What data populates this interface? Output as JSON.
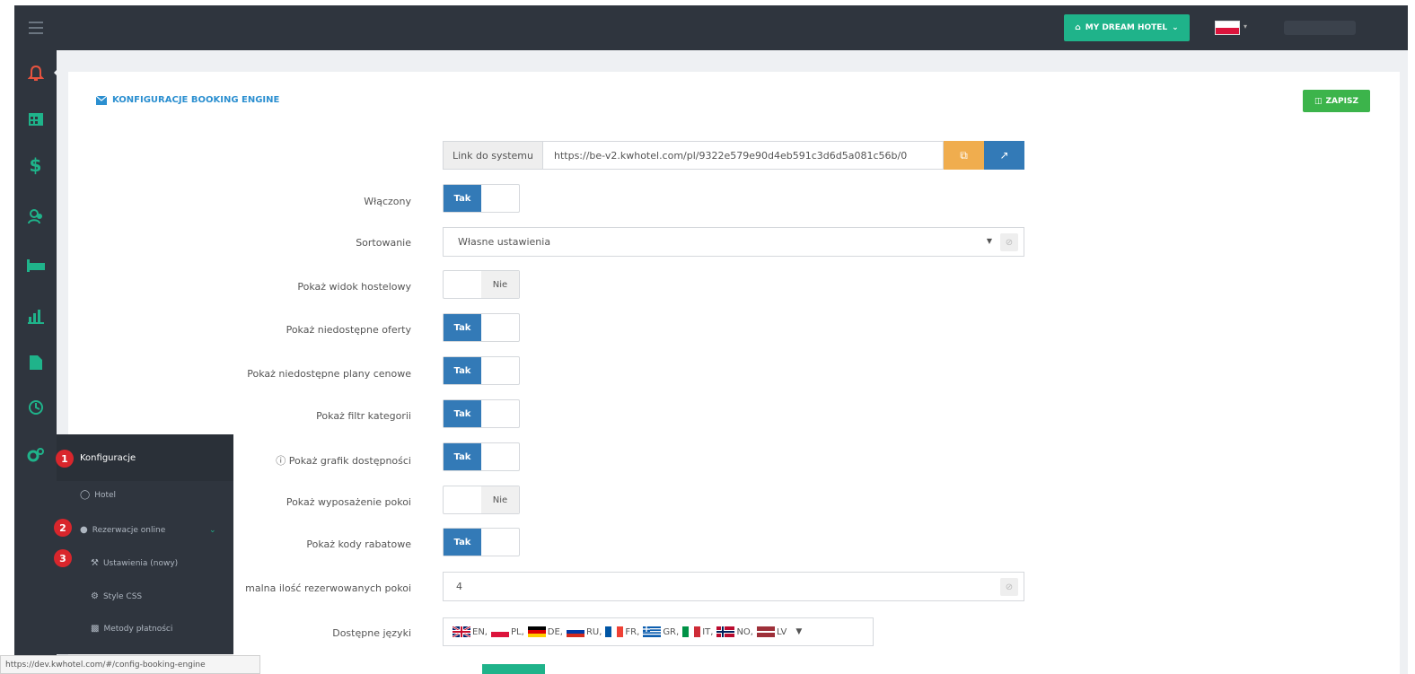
{
  "topbar": {
    "hotel_button": "MY DREAM HOTEL",
    "hotel_icon": "home-icon",
    "language_flag": "pl"
  },
  "sidebar": {
    "icons": [
      "bell-icon",
      "calendar-icon",
      "dollar-icon",
      "users-icon",
      "bed-icon",
      "bar-chart-icon",
      "file-icon",
      "clock-icon",
      "cogs-icon"
    ],
    "colors": {
      "bell": "#e8533f",
      "teal": "#1fb38a"
    }
  },
  "card": {
    "title": "KONFIGURACJE BOOKING ENGINE",
    "save_label": "ZAPISZ"
  },
  "form": {
    "link_label": "Link do systemu",
    "link_value": "https://be-v2.kwhotel.com/pl/9322e579e90d4eb591c3d6d5a081c56b/0",
    "rows": [
      {
        "label": "Włączony",
        "value": "Tak"
      },
      {
        "label": "Sortowanie",
        "value": "Własne ustawienia"
      },
      {
        "label": "Pokaż widok hostelowy",
        "value": "Nie"
      },
      {
        "label": "Pokaż niedostępne oferty",
        "value": "Tak"
      },
      {
        "label": "Pokaż niedostępne plany cenowe",
        "value": "Tak"
      },
      {
        "label": "Pokaż filtr kategorii",
        "value": "Tak"
      },
      {
        "label": "Pokaż grafik dostępności",
        "value": "Tak"
      },
      {
        "label": "Pokaż wyposażenie pokoi",
        "value": "Nie"
      },
      {
        "label": "Pokaż kody rabatowe",
        "value": "Tak"
      },
      {
        "label": "malna ilość rezerwowanych pokoi",
        "value": "4"
      },
      {
        "label": "Dostępne języki",
        "value": ""
      }
    ],
    "languages": [
      "EN,",
      "PL,",
      "DE,",
      "RU,",
      "FR,",
      "GR,",
      "IT,",
      "NO,",
      "LV"
    ]
  },
  "flyout": {
    "title": "Konfiguracje",
    "items": [
      "Hotel",
      "Rezerwacje online",
      "Ustawienia (nowy)",
      "Style CSS",
      "Metody płatności"
    ],
    "badges": [
      "1",
      "2",
      "3"
    ]
  },
  "status_bar": "https://dev.kwhotel.com/#/config-booking-engine"
}
